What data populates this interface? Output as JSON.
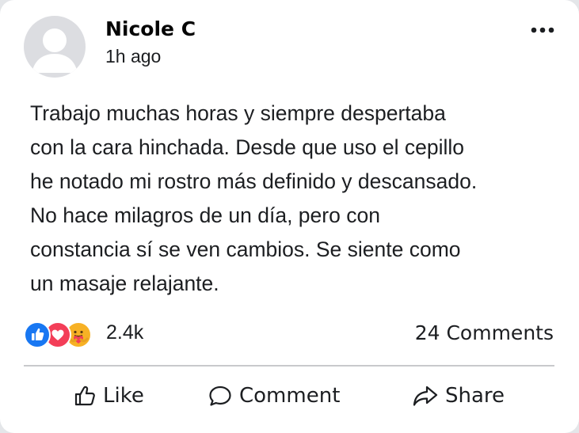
{
  "post": {
    "author": "Nicole C",
    "timestamp": "1h ago",
    "text": "Trabajo muchas horas y siempre despertaba\ncon la cara hinchada. Desde que uso el cepillo\nhe notado mi rostro más definido y descansado.\nNo hace milagros de un día, pero con\nconstancia sí se ven cambios. Se siente como\nun masaje relajante."
  },
  "reactions": {
    "icons": [
      "like-icon",
      "love-icon",
      "care-icon"
    ],
    "count": "2.4k",
    "colors": {
      "like": "#1877f2",
      "love": "#f33e58",
      "care": "#f7b125"
    }
  },
  "comments": {
    "count_label": "24 Comments"
  },
  "actions": {
    "like_label": "Like",
    "comment_label": "Comment",
    "share_label": "Share"
  }
}
